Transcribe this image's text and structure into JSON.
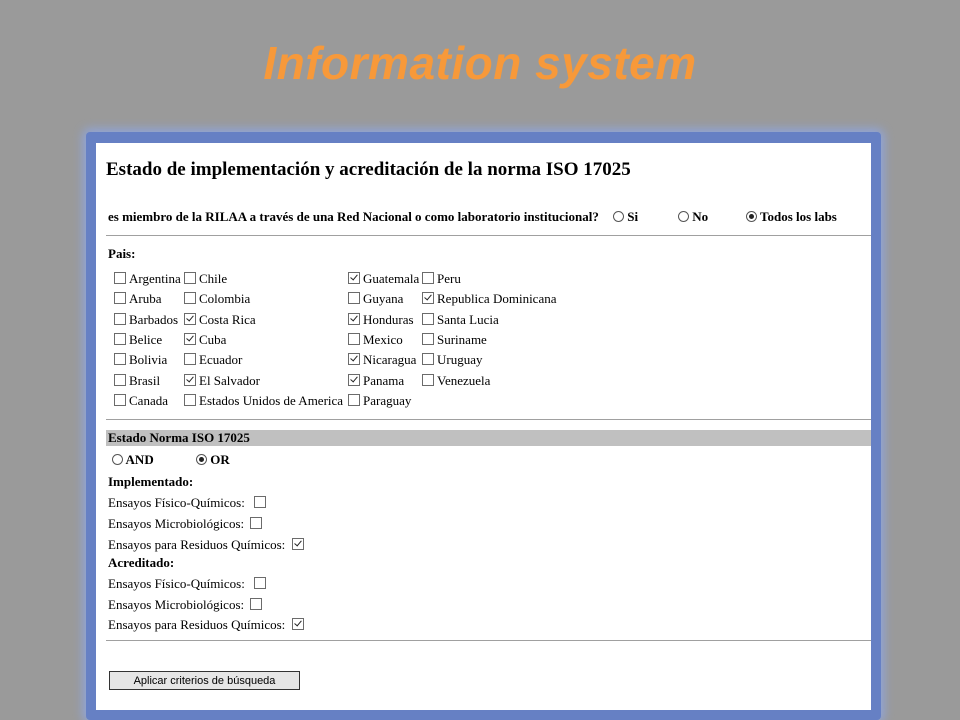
{
  "slide_title": "Information system",
  "form": {
    "heading": "Estado de implementación y acreditación de la norma ISO 17025",
    "membership": {
      "question": "es miembro de la RILAA a través de una Red Nacional o como laboratorio institucional?",
      "options": [
        {
          "label": "Si",
          "selected": false
        },
        {
          "label": "No",
          "selected": false
        },
        {
          "label": "Todos los labs",
          "selected": true
        }
      ]
    },
    "pais_label": "Pais:",
    "countries": [
      {
        "label": "Argentina",
        "checked": false
      },
      {
        "label": "Aruba",
        "checked": false
      },
      {
        "label": "Barbados",
        "checked": false
      },
      {
        "label": "Belice",
        "checked": false
      },
      {
        "label": "Bolivia",
        "checked": false
      },
      {
        "label": "Brasil",
        "checked": false
      },
      {
        "label": "Canada",
        "checked": false
      },
      {
        "label": "Chile",
        "checked": false
      },
      {
        "label": "Colombia",
        "checked": false
      },
      {
        "label": "Costa Rica",
        "checked": true
      },
      {
        "label": "Cuba",
        "checked": true
      },
      {
        "label": "Ecuador",
        "checked": false
      },
      {
        "label": "El Salvador",
        "checked": true
      },
      {
        "label": "Estados Unidos de America",
        "checked": false
      },
      {
        "label": "Guatemala",
        "checked": true
      },
      {
        "label": "Guyana",
        "checked": false
      },
      {
        "label": "Honduras",
        "checked": true
      },
      {
        "label": "Mexico",
        "checked": false
      },
      {
        "label": "Nicaragua",
        "checked": true
      },
      {
        "label": "Panama",
        "checked": true
      },
      {
        "label": "Paraguay",
        "checked": false
      },
      {
        "label": "Peru",
        "checked": false
      },
      {
        "label": "Republica Dominicana",
        "checked": true
      },
      {
        "label": "Santa Lucia",
        "checked": false
      },
      {
        "label": "Suriname",
        "checked": false
      },
      {
        "label": "Uruguay",
        "checked": false
      },
      {
        "label": "Venezuela",
        "checked": false
      }
    ],
    "norma_section": "Estado Norma ISO 17025",
    "logic": [
      {
        "label": "AND",
        "selected": false
      },
      {
        "label": "OR",
        "selected": true
      }
    ],
    "implementado": {
      "label": "Implementado:",
      "items": [
        {
          "label": "Ensayos Físico-Químicos:",
          "checked": false
        },
        {
          "label": "Ensayos Microbiológicos:",
          "checked": false
        },
        {
          "label": "Ensayos para Residuos Químicos:",
          "checked": true
        }
      ]
    },
    "acreditado": {
      "label": "Acreditado:",
      "items": [
        {
          "label": "Ensayos Físico-Químicos:",
          "checked": false
        },
        {
          "label": "Ensayos Microbiológicos:",
          "checked": false
        },
        {
          "label": "Ensayos para Residuos Químicos:",
          "checked": true
        }
      ]
    },
    "submit_label": "Aplicar criterios de búsqueda"
  }
}
